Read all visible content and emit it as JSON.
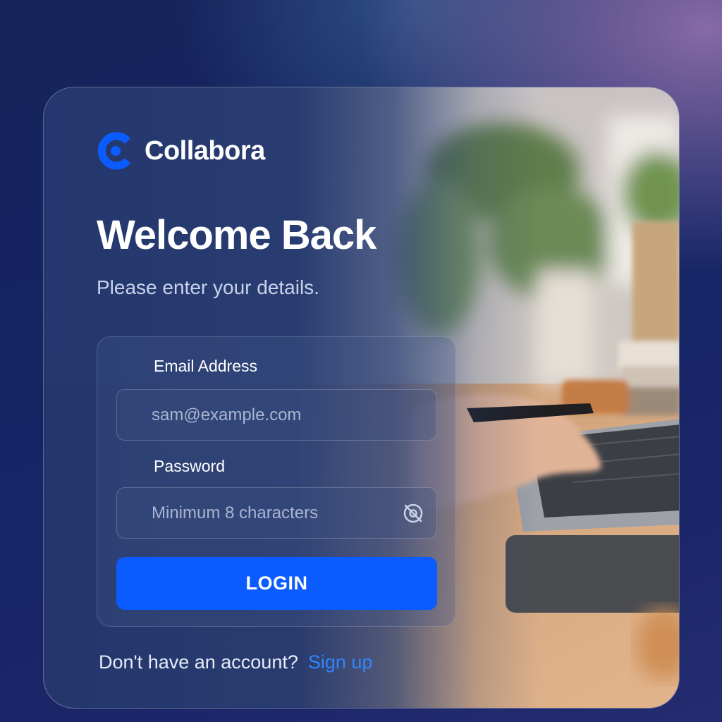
{
  "brand": {
    "name": "Collabora",
    "accent_color": "#0b5cff"
  },
  "heading": {
    "title": "Welcome Back",
    "subtitle": "Please enter your details."
  },
  "form": {
    "email_label": "Email Address",
    "email_placeholder": "sam@example.com",
    "password_label": "Password",
    "password_placeholder": "Minimum 8 characters",
    "password_toggle_icon": "eye-off-icon",
    "login_label": "LOGIN"
  },
  "footer": {
    "prompt": "Don't have an account?",
    "signup_label": "Sign up",
    "link_color": "#2f86ff"
  }
}
